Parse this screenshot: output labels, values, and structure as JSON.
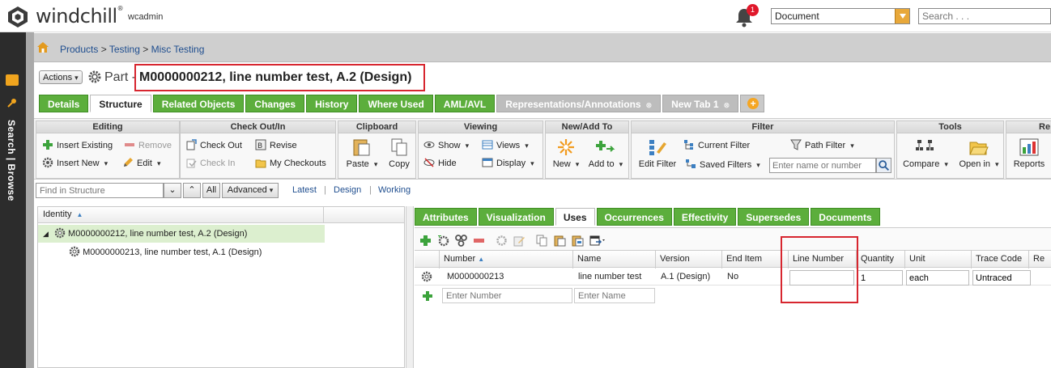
{
  "header": {
    "brand": "windchill",
    "trademark": "®",
    "user": "wcadmin",
    "notification_count": "1",
    "context_select_value": "Document",
    "search_placeholder": "Search . . ."
  },
  "rail": {
    "label": "Search | Browse"
  },
  "breadcrumb": {
    "items": [
      "Products",
      "Testing",
      "Misc Testing"
    ],
    "separator": ">"
  },
  "title": {
    "actions_label": "Actions",
    "prefix": "Part -",
    "name": "M0000000212, line number test, A.2 (Design)"
  },
  "tabs": [
    {
      "label": "Details"
    },
    {
      "label": "Structure"
    },
    {
      "label": "Related Objects"
    },
    {
      "label": "Changes"
    },
    {
      "label": "History"
    },
    {
      "label": "Where Used"
    },
    {
      "label": "AML/AVL"
    },
    {
      "label": "Representations/Annotations"
    },
    {
      "label": "New Tab 1"
    }
  ],
  "ribbon": {
    "editing": {
      "title": "Editing",
      "insert_existing": "Insert Existing",
      "remove": "Remove",
      "insert_new": "Insert New",
      "edit": "Edit"
    },
    "checkout": {
      "title": "Check Out/In",
      "check_out": "Check Out",
      "revise": "Revise",
      "check_in": "Check In",
      "my_checkouts": "My Checkouts"
    },
    "clipboard": {
      "title": "Clipboard",
      "paste": "Paste",
      "copy": "Copy"
    },
    "viewing": {
      "title": "Viewing",
      "show": "Show",
      "views": "Views",
      "hide": "Hide",
      "display": "Display"
    },
    "newadd": {
      "title": "New/Add To",
      "new": "New",
      "add_to": "Add to"
    },
    "filter": {
      "title": "Filter",
      "edit_filter": "Edit Filter",
      "current_filter": "Current Filter",
      "path_filter": "Path Filter",
      "saved_filters": "Saved Filters",
      "filter_placeholder": "Enter name or number"
    },
    "tools": {
      "title": "Tools",
      "compare": "Compare",
      "open_in": "Open in"
    },
    "reports": {
      "title": "Re",
      "reports": "Reports"
    }
  },
  "find": {
    "placeholder": "Find in Structure",
    "all": "All",
    "advanced": "Advanced",
    "latest": "Latest",
    "design": "Design",
    "working": "Working"
  },
  "tree": {
    "column": "Identity",
    "rows": [
      {
        "label": "M0000000212, line number test, A.2 (Design)"
      },
      {
        "label": "M0000000213, line number test, A.1 (Design)"
      }
    ]
  },
  "subtabs": [
    {
      "label": "Attributes"
    },
    {
      "label": "Visualization"
    },
    {
      "label": "Uses"
    },
    {
      "label": "Occurrences"
    },
    {
      "label": "Effectivity"
    },
    {
      "label": "Supersedes"
    },
    {
      "label": "Documents"
    }
  ],
  "grid": {
    "columns": [
      "Number",
      "Name",
      "Version",
      "End Item",
      "Line Number",
      "Quantity",
      "Unit",
      "Trace Code",
      "Re"
    ],
    "row": {
      "number": "M0000000213",
      "name": "line number test",
      "version": "A.1 (Design)",
      "end_item": "No",
      "line_number": "",
      "quantity": "1",
      "unit": "each",
      "trace_code": "Untraced"
    },
    "new_row": {
      "number_placeholder": "Enter Number",
      "name_placeholder": "Enter Name"
    }
  },
  "colors": {
    "tab_green": "#5cae3c",
    "highlight_red": "#d7262f",
    "accent_orange": "#f0a41e"
  }
}
